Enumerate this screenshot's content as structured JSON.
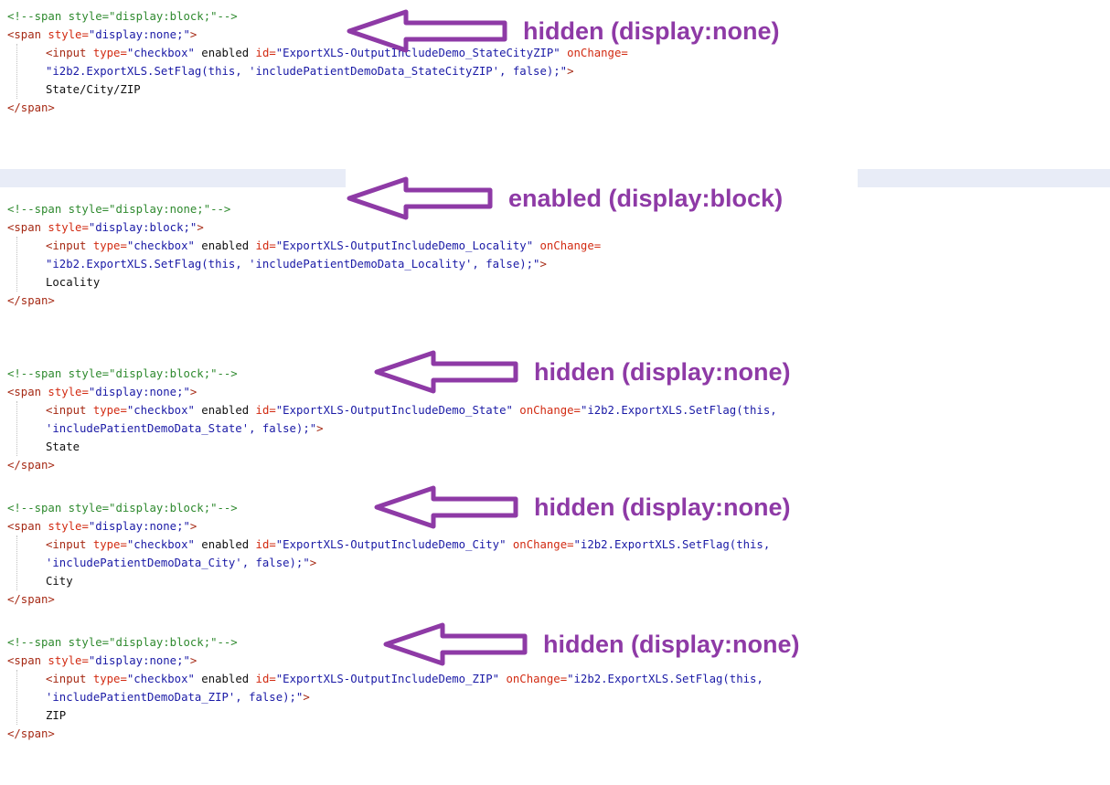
{
  "blocks": [
    {
      "comment": "<!--span style=\"display:block;\"-->",
      "span_style": "display:none;",
      "input_lines": [
        [
          {
            "t": "<input ",
            "c": "tag"
          },
          {
            "t": "type=",
            "c": "attr"
          },
          {
            "t": "\"checkbox\"",
            "c": "str"
          },
          {
            "t": " enabled ",
            "c": "txt"
          },
          {
            "t": "id=",
            "c": "attr"
          },
          {
            "t": "\"ExportXLS-OutputIncludeDemo_StateCityZIP\"",
            "c": "str"
          },
          {
            "t": " ",
            "c": "txt"
          },
          {
            "t": "onChange=",
            "c": "attr"
          }
        ],
        [
          {
            "t": "\"i2b2.ExportXLS.SetFlag(this, 'includePatientDemoData_StateCityZIP', false);\"",
            "c": "str"
          },
          {
            "t": ">",
            "c": "tag"
          }
        ]
      ],
      "label": "State/City/ZIP",
      "annotation": "hidden (display:none)"
    },
    {
      "comment": "<!--span style=\"display:none;\"-->",
      "span_style": "display:block;",
      "input_lines": [
        [
          {
            "t": "<input ",
            "c": "tag"
          },
          {
            "t": "type=",
            "c": "attr"
          },
          {
            "t": "\"checkbox\"",
            "c": "str"
          },
          {
            "t": " enabled ",
            "c": "txt"
          },
          {
            "t": "id=",
            "c": "attr"
          },
          {
            "t": "\"ExportXLS-OutputIncludeDemo_Locality\"",
            "c": "str"
          },
          {
            "t": " ",
            "c": "txt"
          },
          {
            "t": "onChange=",
            "c": "attr"
          }
        ],
        [
          {
            "t": "\"i2b2.ExportXLS.SetFlag(this, 'includePatientDemoData_Locality', false);\"",
            "c": "str"
          },
          {
            "t": ">",
            "c": "tag"
          }
        ]
      ],
      "label": "Locality",
      "annotation": "enabled (display:block)"
    },
    {
      "comment": "<!--span style=\"display:block;\"-->",
      "span_style": "display:none;",
      "input_lines": [
        [
          {
            "t": "<input ",
            "c": "tag"
          },
          {
            "t": "type=",
            "c": "attr"
          },
          {
            "t": "\"checkbox\"",
            "c": "str"
          },
          {
            "t": " enabled ",
            "c": "txt"
          },
          {
            "t": "id=",
            "c": "attr"
          },
          {
            "t": "\"ExportXLS-OutputIncludeDemo_State\"",
            "c": "str"
          },
          {
            "t": " ",
            "c": "txt"
          },
          {
            "t": "onChange=",
            "c": "attr"
          },
          {
            "t": "\"i2b2.ExportXLS.SetFlag(this,",
            "c": "str"
          }
        ],
        [
          {
            "t": "'includePatientDemoData_State', false);\"",
            "c": "str"
          },
          {
            "t": ">",
            "c": "tag"
          }
        ]
      ],
      "label": "State",
      "annotation": "hidden (display:none)"
    },
    {
      "comment": "<!--span style=\"display:block;\"-->",
      "span_style": "display:none;",
      "input_lines": [
        [
          {
            "t": "<input ",
            "c": "tag"
          },
          {
            "t": "type=",
            "c": "attr"
          },
          {
            "t": "\"checkbox\"",
            "c": "str"
          },
          {
            "t": " enabled ",
            "c": "txt"
          },
          {
            "t": "id=",
            "c": "attr"
          },
          {
            "t": "\"ExportXLS-OutputIncludeDemo_City\"",
            "c": "str"
          },
          {
            "t": " ",
            "c": "txt"
          },
          {
            "t": "onChange=",
            "c": "attr"
          },
          {
            "t": "\"i2b2.ExportXLS.SetFlag(this,",
            "c": "str"
          }
        ],
        [
          {
            "t": "'includePatientDemoData_City', false);\"",
            "c": "str"
          },
          {
            "t": ">",
            "c": "tag"
          }
        ]
      ],
      "label": "City",
      "annotation": "hidden (display:none)"
    },
    {
      "comment": "<!--span style=\"display:block;\"-->",
      "span_style": "display:none;",
      "input_lines": [
        [
          {
            "t": "<input ",
            "c": "tag"
          },
          {
            "t": "type=",
            "c": "attr"
          },
          {
            "t": "\"checkbox\"",
            "c": "str"
          },
          {
            "t": " enabled ",
            "c": "txt"
          },
          {
            "t": "id=",
            "c": "attr"
          },
          {
            "t": "\"ExportXLS-OutputIncludeDemo_ZIP\"",
            "c": "str"
          },
          {
            "t": " ",
            "c": "txt"
          },
          {
            "t": "onChange=",
            "c": "attr"
          },
          {
            "t": "\"i2b2.ExportXLS.SetFlag(this,",
            "c": "str"
          }
        ],
        [
          {
            "t": "'includePatientDemoData_ZIP', false);\"",
            "c": "str"
          },
          {
            "t": ">",
            "c": "tag"
          }
        ]
      ],
      "label": "ZIP",
      "annotation": "hidden (display:none)"
    }
  ],
  "syntax": {
    "span_open_prefix": "<span ",
    "style_attr": "style=",
    "tag_close": ">",
    "span_close": "</span>"
  },
  "colors": {
    "comment": "#2f8a2f",
    "tag": "#a62a15",
    "attribute": "#d22b12",
    "string": "#1a1aa6",
    "annotation": "#8e3aa6",
    "band": "#e8ecf7"
  },
  "icons": {
    "annotation_arrow": "left-arrow-outline-icon"
  }
}
